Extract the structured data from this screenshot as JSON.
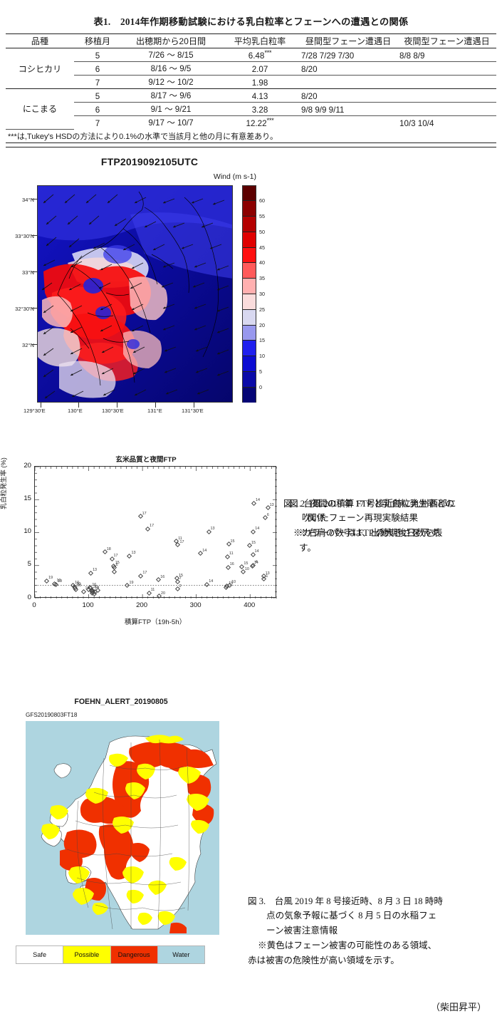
{
  "table1": {
    "caption": "表1.　2014年作期移動試験における乳白粒率とフェーンへの遭遇との関係",
    "headers": [
      "品種",
      "移植月",
      "出穂期から20日間",
      "平均乳白粒率",
      "昼間型フェーン遭遇日",
      "夜間型フェーン遭遇日"
    ],
    "rows": [
      {
        "variety": "コシヒカリ",
        "month": "5",
        "period": "7/26 ～ 8/15",
        "rate": "6.48",
        "star": "***",
        "day": "7/28 7/29 7/30",
        "night": "8/8 8/9"
      },
      {
        "variety": "",
        "month": "6",
        "period": "8/16 ～ 9/5",
        "rate": "2.07",
        "star": "",
        "day": "8/20",
        "night": ""
      },
      {
        "variety": "",
        "month": "7",
        "period": "9/12 ～ 10/2",
        "rate": "1.98",
        "star": "",
        "day": "",
        "night": ""
      },
      {
        "variety": "にこまる",
        "month": "5",
        "period": "8/17 ～ 9/6",
        "rate": "4.13",
        "star": "",
        "day": "8/20",
        "night": ""
      },
      {
        "variety": "",
        "month": "6",
        "period": "9/1 ～ 9/21",
        "rate": "3.28",
        "star": "",
        "day": "9/8 9/9 9/11",
        "night": ""
      },
      {
        "variety": "",
        "month": "7",
        "period": "9/17 ～ 10/7",
        "rate": "12.22",
        "star": "***",
        "day": "",
        "night": "10/3 10/4"
      }
    ],
    "footnote": "***は,Tukey's HSDの方法により0.1%の水準で当該月と他の月に有意差あり。"
  },
  "fig1": {
    "title": "FTP2019092105UTC",
    "unit_label": "Wind (m s-1)",
    "lat_ticks": [
      "34°N",
      "33°30'N",
      "33°N",
      "32°30'N",
      "32°N"
    ],
    "lon_ticks": [
      "129°30'E",
      "130°E",
      "130°30'E",
      "131°E",
      "131°30'E"
    ],
    "colorbar_ticks": [
      "60",
      "55",
      "50",
      "45",
      "40",
      "35",
      "30",
      "25",
      "20",
      "15",
      "10",
      "5",
      "0"
    ],
    "caption_line1": "図 1. 台風 2019 年 17 号接近時に九州西部に",
    "caption_line2": "吹いたフェーン再現実験結果",
    "caption_line3": "※カラーバーは FTP の大きさを示す。"
  },
  "fig2": {
    "caption_line1": "図 2. 夜間の積算 FTP と乳白粒発生率との",
    "caption_line2": "関係",
    "caption_line3": "※右肩の数字は、出穂期後日数を表",
    "caption_line4": "す。"
  },
  "chart_data": {
    "type": "scatter",
    "title": "玄米品質と夜間FTP",
    "xlabel": "積算FTP（19h-5h）",
    "ylabel": "乳白粒発生率 (%)",
    "xlim": [
      0,
      450
    ],
    "ylim": [
      0,
      20
    ],
    "xticks": [
      0,
      100,
      200,
      300,
      400
    ],
    "yticks": [
      0,
      5,
      10,
      15,
      20
    ],
    "grid": false,
    "legend": "none",
    "annotations": [
      {
        "text": "reference line at y = 2 (dotted)",
        "y": 2,
        "style": "dotted-horizontal"
      }
    ],
    "point_label_meaning": "days after heading (出穂期後日数)",
    "points": [
      {
        "x": 22,
        "y": 2.6,
        "label": "19"
      },
      {
        "x": 37,
        "y": 2.2,
        "label": "19"
      },
      {
        "x": 39,
        "y": 2.1,
        "label": "19"
      },
      {
        "x": 71,
        "y": 1.9,
        "label": "10"
      },
      {
        "x": 74,
        "y": 1.7,
        "label": "20"
      },
      {
        "x": 75,
        "y": 1.5,
        "label": "20"
      },
      {
        "x": 76,
        "y": 1.3,
        "label": ""
      },
      {
        "x": 90,
        "y": 1.0,
        "label": "16"
      },
      {
        "x": 100,
        "y": 1.3,
        "label": ""
      },
      {
        "x": 103,
        "y": 1.6,
        "label": "16"
      },
      {
        "x": 104,
        "y": 1.5,
        "label": ""
      },
      {
        "x": 105,
        "y": 1.2,
        "label": "20"
      },
      {
        "x": 106,
        "y": 1.0,
        "label": ""
      },
      {
        "x": 107,
        "y": 0.8,
        "label": ""
      },
      {
        "x": 108,
        "y": 1.1,
        "label": "14"
      },
      {
        "x": 110,
        "y": 0.6,
        "label": ""
      },
      {
        "x": 104,
        "y": 3.8,
        "label": "13"
      },
      {
        "x": 112,
        "y": 1.0,
        "label": ""
      },
      {
        "x": 117,
        "y": 1.2,
        "label": ""
      },
      {
        "x": 130,
        "y": 7.0,
        "label": "18"
      },
      {
        "x": 143,
        "y": 6.0,
        "label": "17"
      },
      {
        "x": 146,
        "y": 4.9,
        "label": "15"
      },
      {
        "x": 147,
        "y": 4.6,
        "label": "6"
      },
      {
        "x": 147,
        "y": 4.0,
        "label": ""
      },
      {
        "x": 172,
        "y": 1.9,
        "label": "19"
      },
      {
        "x": 176,
        "y": 6.4,
        "label": "13"
      },
      {
        "x": 196,
        "y": 12.4,
        "label": "17"
      },
      {
        "x": 197,
        "y": 3.4,
        "label": "17"
      },
      {
        "x": 210,
        "y": 10.5,
        "label": "17"
      },
      {
        "x": 212,
        "y": 0.8,
        "label": "11"
      },
      {
        "x": 230,
        "y": 2.8,
        "label": "16"
      },
      {
        "x": 231,
        "y": 0.3,
        "label": "20"
      },
      {
        "x": 263,
        "y": 8.6,
        "label": "11"
      },
      {
        "x": 266,
        "y": 8.1,
        "label": "17"
      },
      {
        "x": 264,
        "y": 3.0,
        "label": "15"
      },
      {
        "x": 265,
        "y": 2.5,
        "label": "7"
      },
      {
        "x": 265,
        "y": 1.4,
        "label": "2"
      },
      {
        "x": 308,
        "y": 6.8,
        "label": "14"
      },
      {
        "x": 320,
        "y": 2.1,
        "label": "14"
      },
      {
        "x": 323,
        "y": 10.1,
        "label": "13"
      },
      {
        "x": 355,
        "y": 1.6,
        "label": ""
      },
      {
        "x": 357,
        "y": 1.8,
        "label": "15"
      },
      {
        "x": 358,
        "y": 6.3,
        "label": "11"
      },
      {
        "x": 359,
        "y": 4.7,
        "label": "16"
      },
      {
        "x": 360,
        "y": 8.2,
        "label": "15"
      },
      {
        "x": 362,
        "y": 2.0,
        "label": "10"
      },
      {
        "x": 385,
        "y": 4.8,
        "label": "15"
      },
      {
        "x": 387,
        "y": 4.0,
        "label": "10"
      },
      {
        "x": 399,
        "y": 8.0,
        "label": "15"
      },
      {
        "x": 404,
        "y": 4.9,
        "label": "14"
      },
      {
        "x": 406,
        "y": 5.0,
        "label": "4"
      },
      {
        "x": 405,
        "y": 6.6,
        "label": "14"
      },
      {
        "x": 406,
        "y": 10.1,
        "label": "14"
      },
      {
        "x": 407,
        "y": 14.4,
        "label": "14"
      },
      {
        "x": 425,
        "y": 3.3,
        "label": "13"
      },
      {
        "x": 426,
        "y": 2.9,
        "label": "1"
      },
      {
        "x": 428,
        "y": 12.2,
        "label": "6"
      },
      {
        "x": 433,
        "y": 13.7,
        "label": "13"
      }
    ]
  },
  "fig3": {
    "title": "FOEHN_ALERT_20190805",
    "subtitle": "GFS20190803FT18",
    "legend": [
      {
        "label": "Safe",
        "color": "#ffffff"
      },
      {
        "label": "Possible",
        "color": "#ffff00"
      },
      {
        "label": "Dangerous",
        "color": "#f03000"
      },
      {
        "label": "Water",
        "color": "#aed5e0"
      }
    ],
    "caption_line1": "図 3.　台風 2019 年 8 号接近時、8 月 3 日 18 時時",
    "caption_line2": "点の気象予報に基づく 8 月 5 日の水稲フェ",
    "caption_line3": "ーン被害注意情報",
    "caption_line4": "※黄色はフェーン被害の可能性のある領域、",
    "caption_line5": "赤は被害の危険性が高い領域を示す。"
  },
  "signature": "（柴田昇平）"
}
